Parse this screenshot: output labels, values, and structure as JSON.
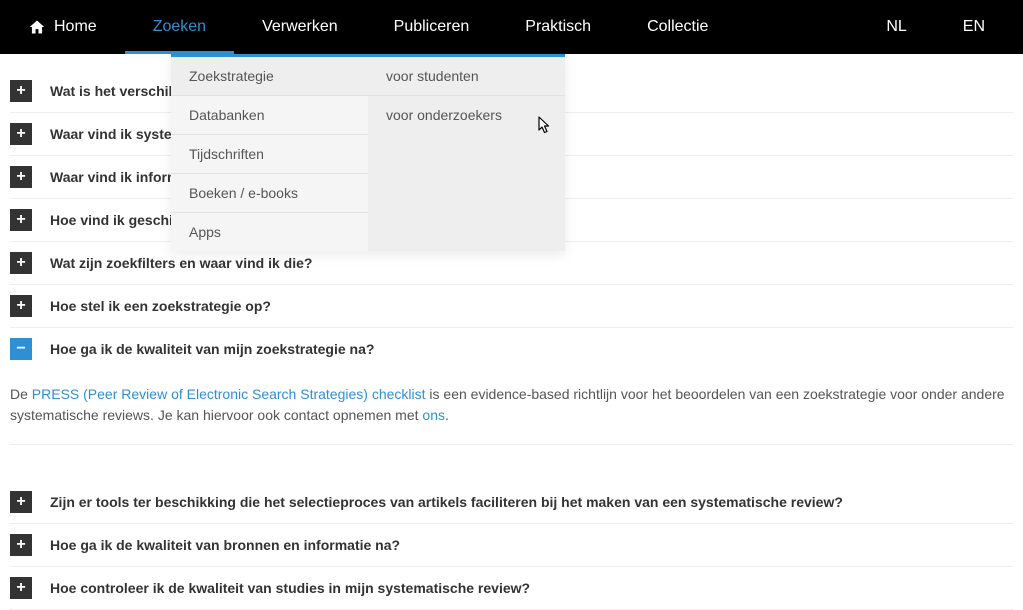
{
  "nav": {
    "home": "Home",
    "zoeken": "Zoeken",
    "verwerken": "Verwerken",
    "publiceren": "Publiceren",
    "praktisch": "Praktisch",
    "collectie": "Collectie",
    "lang_nl": "NL",
    "lang_en": "EN"
  },
  "dropdown": {
    "col1": {
      "zoekstrategie": "Zoekstrategie",
      "databanken": "Databanken",
      "tijdschriften": "Tijdschriften",
      "boeken": "Boeken / e-books",
      "apps": "Apps"
    },
    "col2": {
      "voor_studenten": "voor studenten",
      "voor_onderzoekers": "voor onderzoekers"
    }
  },
  "accordion": {
    "q1": "Wat is het verschil tu",
    "q2": "Waar vind ik systema",
    "q3": "Waar vind ik informa",
    "q4": "Hoe vind ik geschikte",
    "q5": "Wat zijn zoekfilters en waar vind ik die?",
    "q6": "Hoe stel ik een zoekstrategie op?",
    "q7": "Hoe ga ik de kwaliteit van mijn zoekstrategie na?",
    "q7_body_pre": "De ",
    "q7_link1": "PRESS (Peer Review of Electronic Search Strategies) checklist",
    "q7_body_mid": " is een evidence-based richtlijn voor het beoordelen van een zoekstrategie voor onder andere systematische reviews. Je kan hiervoor ook contact opnemen met ",
    "q7_link2": "ons",
    "q7_body_post": ".",
    "q8": "Zijn er tools ter beschikking die het selectieproces van artikels faciliteren bij het maken van een systematische review?",
    "q9": "Hoe ga ik de kwaliteit van bronnen en informatie na?",
    "q10": "Hoe controleer ik de kwaliteit van studies in mijn systematische review?"
  },
  "icons": {
    "plus": "+",
    "minus": "−"
  }
}
